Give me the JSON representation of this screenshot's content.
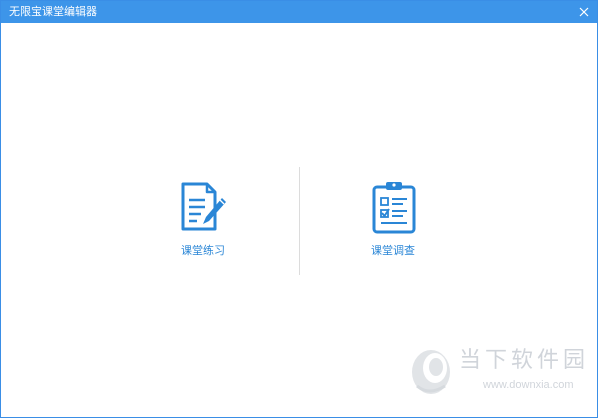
{
  "window": {
    "title": "无限宝课堂编辑器",
    "close_icon": "close-icon"
  },
  "options": [
    {
      "label": "课堂练习",
      "icon": "document-pen-icon"
    },
    {
      "label": "课堂调查",
      "icon": "clipboard-checklist-icon"
    }
  ],
  "watermark": {
    "brand": "当下软件园",
    "url": "www.downxia.com"
  },
  "colors": {
    "titlebar": "#3d95e9",
    "accent": "#2a86d6",
    "divider": "#dcdcdc",
    "watermark": "#aab2bc"
  }
}
